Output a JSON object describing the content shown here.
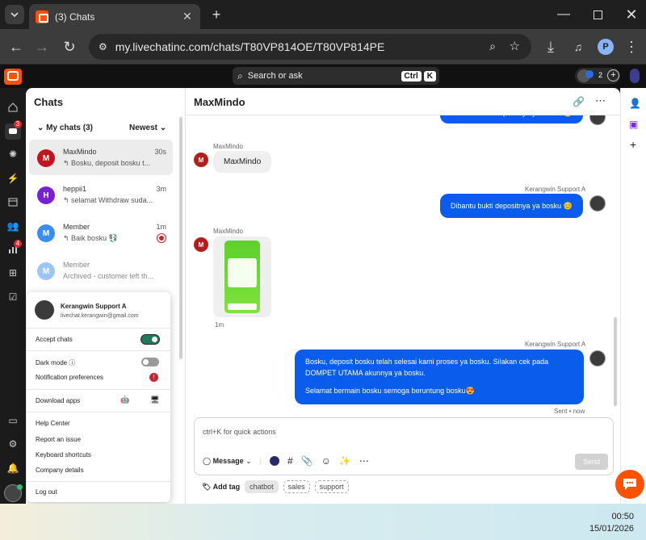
{
  "browser": {
    "tab_title": "(3) Chats",
    "url": "my.livechatinc.com/chats/T80VP814OE/T80VP814PE",
    "profile_initial": "P"
  },
  "topbar": {
    "search_placeholder": "Search or ask",
    "kbd_ctrl": "Ctrl",
    "kbd_k": "K",
    "agents_count": "2"
  },
  "rail": {
    "chats_badge": "3",
    "reports_badge": "4"
  },
  "chats_panel": {
    "title": "Chats",
    "section_label": "My chats (3)",
    "sort_label": "Newest",
    "items": [
      {
        "initial": "M",
        "name": "MaxMindo",
        "preview": "Bosku, deposit bosku t...",
        "time": "30s",
        "color": "#c0141f"
      },
      {
        "initial": "H",
        "name": "heppii1",
        "preview": "selamat Withdraw suda...",
        "time": "3m",
        "color": "#7b1fd6"
      },
      {
        "initial": "M",
        "name": "Member",
        "preview": "Baik bosku 💱",
        "time": "1m",
        "color": "#3a8ef0"
      },
      {
        "initial": "M",
        "name": "Member",
        "preview": "Archived - customer left th...",
        "time": "",
        "color": "#9cc6f5"
      }
    ]
  },
  "conversation": {
    "title": "MaxMindo",
    "top_cut_text": "Dibantu bukti depositnya ya bosku 😊",
    "msg1_sender": "MaxMindo",
    "msg1_text": "MaxMindo",
    "msg2_sender": "Kerangwin Support A",
    "msg2_text": "Dibantu bukti depositnya ya bosku 😊",
    "msg3_sender": "MaxMindo",
    "msg3_time": "1m",
    "msg4_sender": "Kerangwin Support A",
    "msg4_line1": "Bosku, deposit bosku telah selesai kami proses ya bosku. Silakan cek pada",
    "msg4_line2": "DOMPET UTAMA akunnya ya bosku.",
    "msg4_line3": "Selamat bermain bosku semoga beruntung bosku😍",
    "msg4_status": "Sent • now"
  },
  "composer": {
    "placeholder": "ctrl+K for quick actions",
    "message_mode": "Message",
    "send_label": "Send",
    "add_tag_label": "Add tag",
    "tags": [
      "chatbot",
      "sales",
      "support"
    ]
  },
  "profile_menu": {
    "name": "Kerangwin Support A",
    "email": "livechat.kerangwin@gmail.com",
    "accept_chats": "Accept chats",
    "dark_mode": "Dark mode",
    "notification_prefs": "Notification preferences",
    "download_apps": "Download apps",
    "help_center": "Help Center",
    "report_issue": "Report an issue",
    "keyboard_shortcuts": "Keyboard shortcuts",
    "company_details": "Company details",
    "log_out": "Log out"
  },
  "taskbar": {
    "time": "00:50",
    "date": "15/01/2026"
  },
  "colors": {
    "accent_blue": "#0a5dec",
    "brand_orange": "#ff5100",
    "toggle_on": "#1f7a55"
  }
}
